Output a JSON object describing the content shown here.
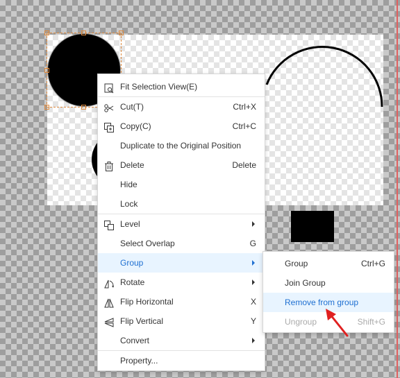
{
  "colors": {
    "accent": "#1e6fd1",
    "highlight_bg": "#e8f4ff",
    "selection": "#e08a3c",
    "annotation": "#e02020"
  },
  "context_menu": {
    "items": [
      {
        "label": "Fit Selection View(E)",
        "shortcut": "",
        "icon": "fit-view-icon"
      },
      {
        "label": "Cut(T)",
        "shortcut": "Ctrl+X",
        "icon": "scissors-icon"
      },
      {
        "label": "Copy(C)",
        "shortcut": "Ctrl+C",
        "icon": "copy-icon"
      },
      {
        "label": "Duplicate to the Original Position",
        "shortcut": ""
      },
      {
        "label": "Delete",
        "shortcut": "Delete",
        "icon": "trash-icon"
      },
      {
        "label": "Hide",
        "shortcut": ""
      },
      {
        "label": "Lock",
        "shortcut": ""
      },
      {
        "label": "Level",
        "shortcut": "",
        "icon": "layers-icon",
        "submenu": true
      },
      {
        "label": "Select Overlap",
        "shortcut": "G"
      },
      {
        "label": "Group",
        "shortcut": "",
        "submenu": true,
        "active": true
      },
      {
        "label": "Rotate",
        "shortcut": "",
        "icon": "rotate-icon",
        "submenu": true
      },
      {
        "label": "Flip Horizontal",
        "shortcut": "X",
        "icon": "flip-horizontal-icon"
      },
      {
        "label": "Flip Vertical",
        "shortcut": "Y",
        "icon": "flip-vertical-icon"
      },
      {
        "label": "Convert",
        "shortcut": "",
        "submenu": true
      },
      {
        "label": "Property...",
        "shortcut": ""
      }
    ]
  },
  "group_submenu": {
    "items": [
      {
        "label": "Group",
        "shortcut": "Ctrl+G"
      },
      {
        "label": "Join Group",
        "shortcut": ""
      },
      {
        "label": "Remove from group",
        "shortcut": "",
        "highlighted": true
      },
      {
        "label": "Ungroup",
        "shortcut": "Shift+G",
        "disabled": true
      }
    ]
  }
}
